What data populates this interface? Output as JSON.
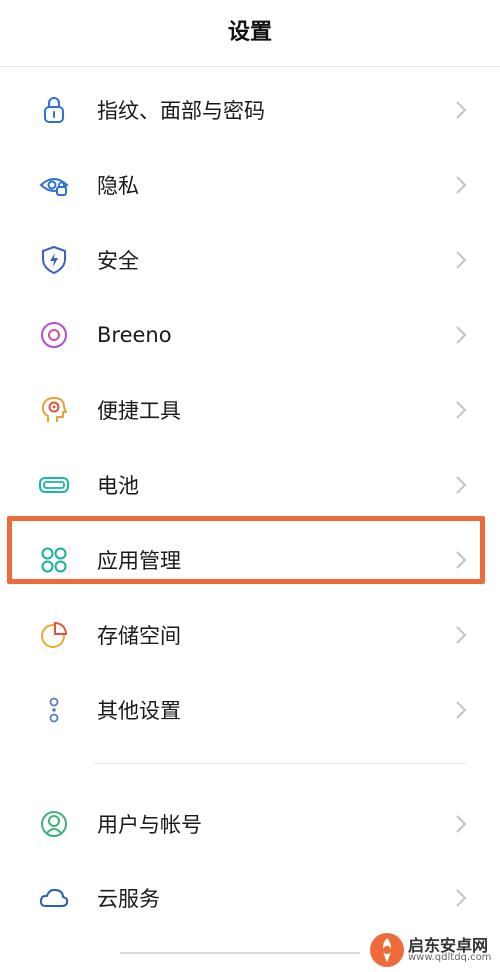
{
  "header": {
    "title": "设置"
  },
  "menu": {
    "group1": [
      {
        "label": "指纹、面部与密码",
        "icon": "lock-icon"
      },
      {
        "label": "隐私",
        "icon": "privacy-eye-icon"
      },
      {
        "label": "安全",
        "icon": "shield-icon"
      },
      {
        "label": "Breeno",
        "icon": "breeno-icon"
      },
      {
        "label": "便捷工具",
        "icon": "head-gear-icon"
      },
      {
        "label": "电池",
        "icon": "battery-icon"
      },
      {
        "label": "应用管理",
        "icon": "app-grid-icon",
        "highlighted": true
      },
      {
        "label": "存储空间",
        "icon": "storage-pie-icon"
      },
      {
        "label": "其他设置",
        "icon": "more-dots-icon"
      }
    ],
    "group2": [
      {
        "label": "用户与帐号",
        "icon": "user-icon"
      },
      {
        "label": "云服务",
        "icon": "cloud-icon"
      }
    ]
  },
  "colors": {
    "highlight_border": "#ef6a3a",
    "lock": "#2f6fd6",
    "privacy": "#2f6fd6",
    "shield": "#3d5fc4",
    "breeno": "#b04fd6",
    "tools": "#e8a23a",
    "battery": "#18b8a6",
    "apps": "#14b1a0",
    "storage": "#f0a82b",
    "more": "#5a7fbf",
    "user": "#3fb27a",
    "cloud": "#2b5fb3",
    "watermark": "#ef6a3a"
  },
  "watermark": {
    "name": "启东安卓网",
    "url": "www.qdltdq.com"
  }
}
